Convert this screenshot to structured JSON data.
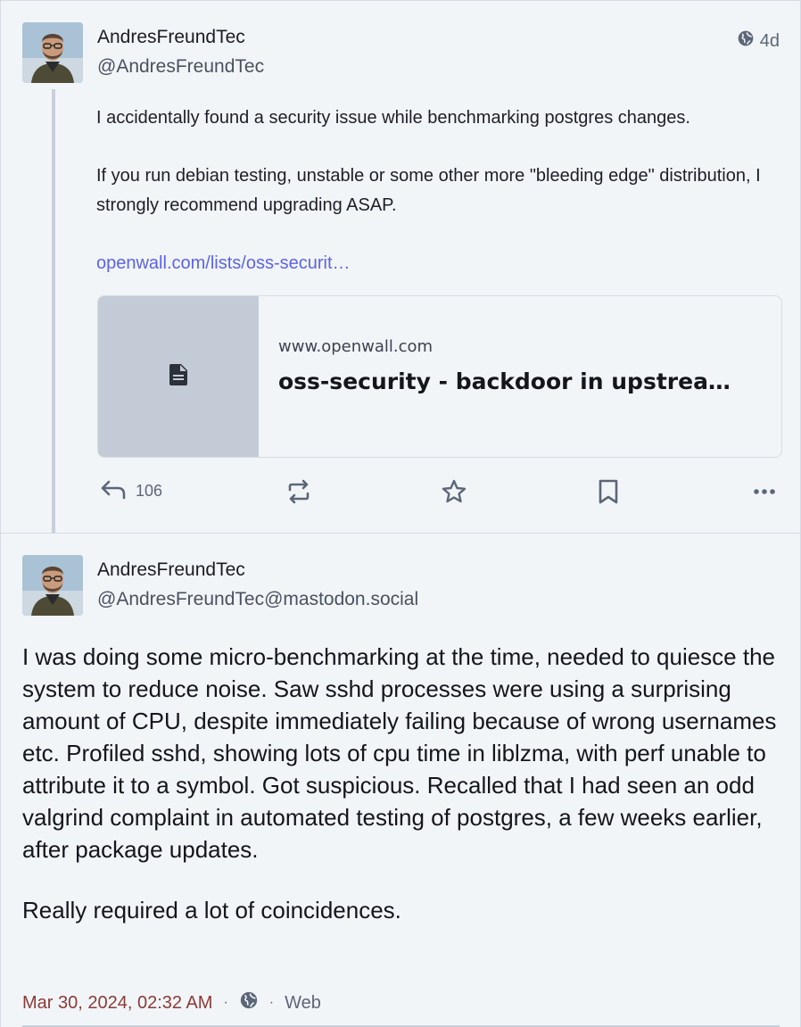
{
  "post1": {
    "author_name": "AndresFreundTec",
    "author_handle": "@AndresFreundTec",
    "visibility_icon": "globe-icon",
    "time_ago": "4d",
    "paragraphs": [
      "I accidentally found a security issue while benchmarking postgres changes.",
      "If you run debian testing, unstable or some other more \"bleeding edge\" distribution, I strongly recommend upgrading ASAP."
    ],
    "link_text": "openwall.com/lists/oss-securit…",
    "card": {
      "thumb_icon": "document-icon",
      "host": "www.openwall.com",
      "title": "oss-security - backdoor in upstrea…"
    },
    "actions": {
      "reply_icon": "reply-icon",
      "reply_count": "106",
      "boost_icon": "boost-icon",
      "favourite_icon": "star-icon",
      "bookmark_icon": "bookmark-icon",
      "more_icon": "more-icon"
    }
  },
  "post2": {
    "author_name": "AndresFreundTec",
    "author_handle": "@AndresFreundTec@mastodon.social",
    "paragraphs": [
      "I was doing some micro-benchmarking at the time, needed to quiesce the system to reduce noise. Saw sshd processes were using a surprising amount of CPU, despite immediately failing because of wrong usernames etc. Profiled sshd, showing lots of cpu time in liblzma, with perf unable to attribute it to a symbol. Got suspicious. Recalled that I had seen an odd valgrind complaint in automated testing of postgres, a few weeks earlier, after  package updates.",
      "Really required a lot of coincidences."
    ],
    "footer": {
      "date": "Mar 30, 2024, 02:32 AM",
      "separator": "·",
      "visibility_icon": "globe-icon",
      "application": "Web"
    }
  },
  "colors": {
    "background": "#f2f5f8",
    "link": "#5b63e6",
    "muted": "#5c6678",
    "date": "#8a3b36",
    "card_thumb": "#c3ccd6"
  }
}
